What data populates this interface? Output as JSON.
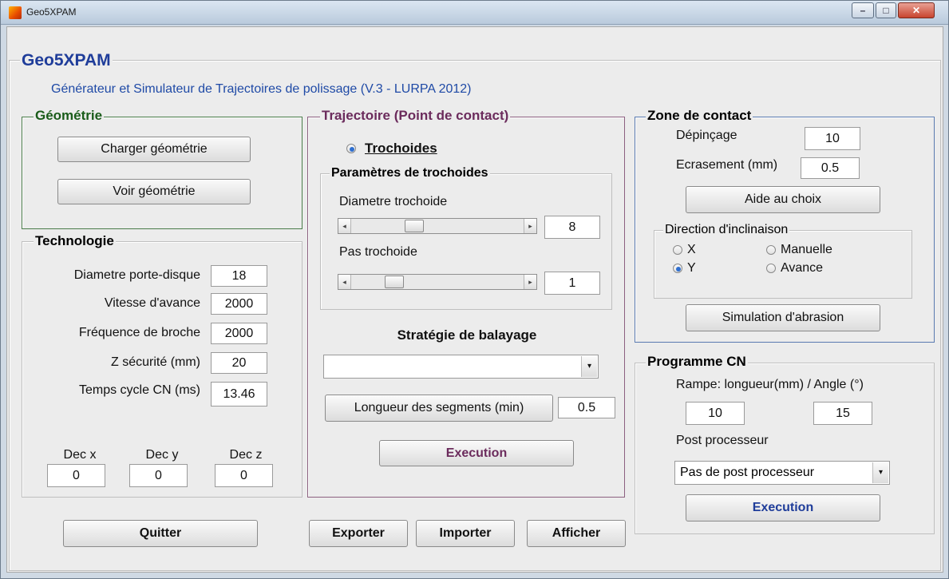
{
  "window": {
    "title": "Geo5XPAM",
    "controls": {
      "minimize": "–",
      "maximize": "□",
      "close": "✕"
    }
  },
  "app": {
    "title": "Geo5XPAM",
    "subtitle": "Générateur et Simulateur de Trajectoires de polissage (V.3 - LURPA 2012)"
  },
  "geometrie": {
    "title": "Géométrie",
    "load_label": "Charger géométrie",
    "view_label": "Voir géométrie"
  },
  "technologie": {
    "title": "Technologie",
    "fields": [
      {
        "label": "Diametre porte-disque",
        "value": "18"
      },
      {
        "label": "Vitesse d'avance",
        "value": "2000"
      },
      {
        "label": "Fréquence de broche",
        "value": "2000"
      },
      {
        "label": "Z sécurité (mm)",
        "value": "20"
      },
      {
        "label": "Temps cycle CN (ms)",
        "value": "13.46"
      }
    ],
    "decs": [
      {
        "label": "Dec x",
        "value": "0"
      },
      {
        "label": "Dec y",
        "value": "0"
      },
      {
        "label": "Dec z",
        "value": "0"
      }
    ]
  },
  "trajectoire": {
    "title": "Trajectoire (Point de contact)",
    "radio_label": "Trochoides",
    "params": {
      "title": "Paramètres de trochoides",
      "diametre_label": "Diametre trochoide",
      "diametre_value": "8",
      "diametre_pos": 0.35,
      "pas_label": "Pas trochoide",
      "pas_value": "1",
      "pas_pos": 0.22
    },
    "strategie_label": "Stratégie de balayage",
    "strategie_value": "",
    "segments_label": "Longueur des segments (min)",
    "segments_value": "0.5",
    "execution_label": "Execution"
  },
  "zone": {
    "title": "Zone de contact",
    "depincage_label": "Dépinçage",
    "depincage_value": "10",
    "ecrasement_label": "Ecrasement (mm)",
    "ecrasement_value": "0.5",
    "aide_label": "Aide au choix",
    "direction": {
      "title": "Direction d'inclinaison",
      "options": [
        "X",
        "Manuelle",
        "Y",
        "Avance"
      ],
      "selected": "Y"
    },
    "simulation_label": "Simulation d'abrasion"
  },
  "programme": {
    "title": "Programme CN",
    "rampe_label": "Rampe: longueur(mm) / Angle (°)",
    "rampe_length": "10",
    "rampe_angle": "15",
    "post_label": "Post processeur",
    "post_value": "Pas de post processeur",
    "execution_label": "Execution"
  },
  "buttons": {
    "quitter": "Quitter",
    "exporter": "Exporter",
    "importer": "Importer",
    "afficher": "Afficher"
  },
  "colors": {
    "app_title": "#1f3d9a",
    "subtitle": "#1f4aa6",
    "geometrie_border": "#4a7c4a",
    "trajectoire_title": "#6b2b5c",
    "trajectoire_border": "#8c6080",
    "zone_border": "#5a7ab0",
    "execution_text": "#6b2b5c",
    "programme_execution_text": "#1f3d9a"
  }
}
